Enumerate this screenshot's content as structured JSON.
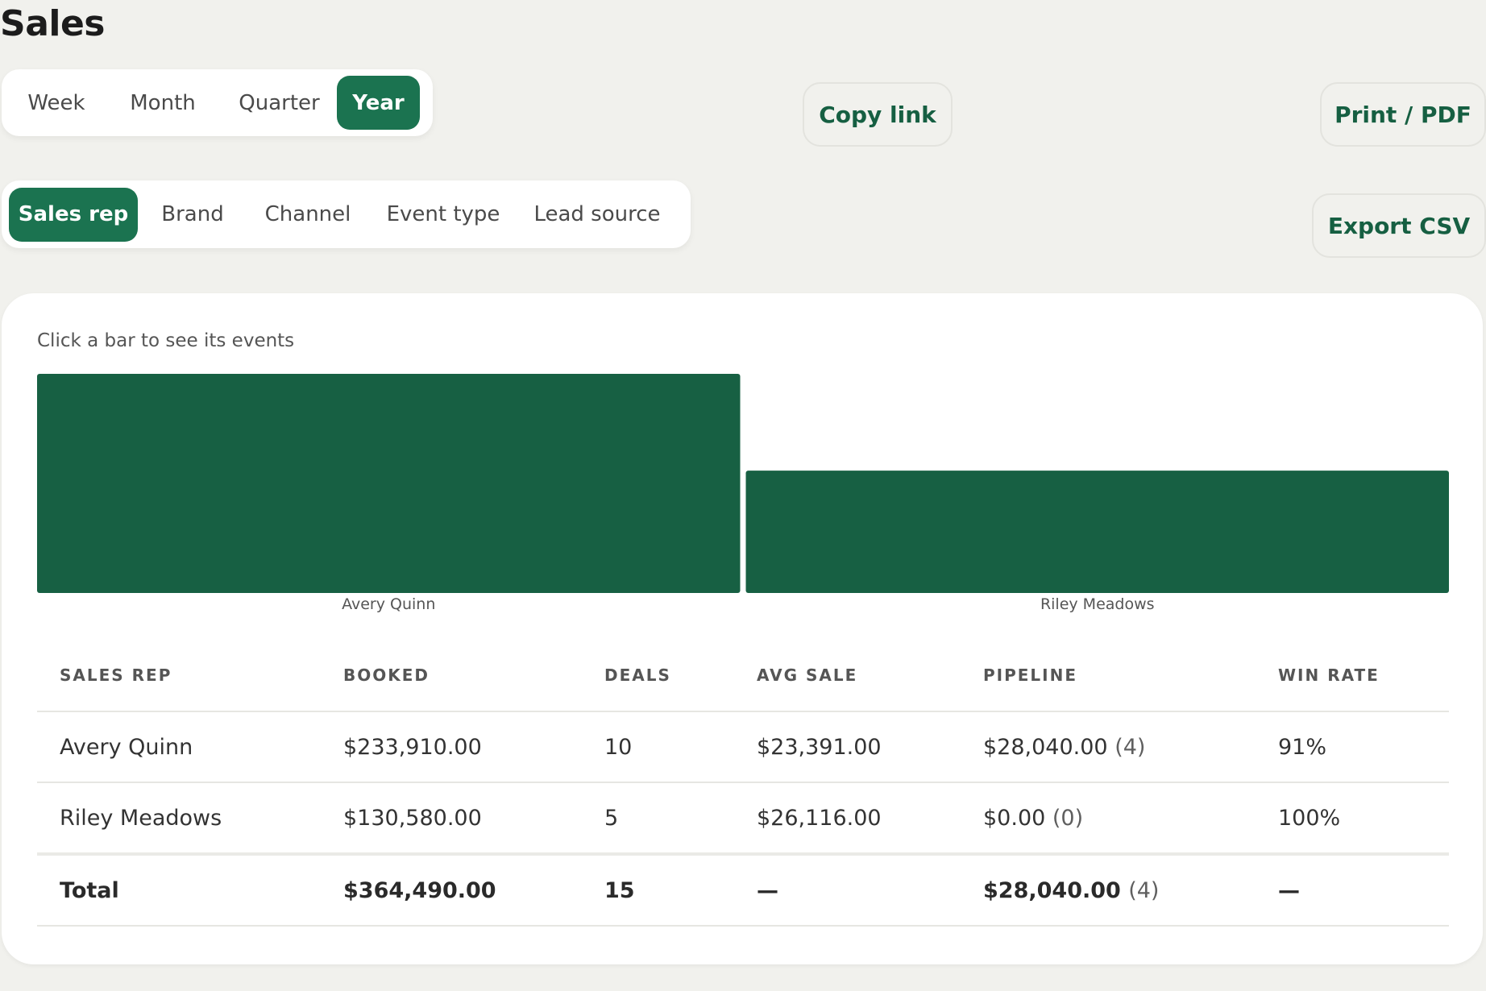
{
  "page": {
    "title": "Sales"
  },
  "period_tabs": {
    "items": [
      {
        "label": "Week"
      },
      {
        "label": "Month"
      },
      {
        "label": "Quarter"
      },
      {
        "label": "Year"
      }
    ],
    "selected": "Year"
  },
  "group_tabs": {
    "items": [
      {
        "label": "Sales rep"
      },
      {
        "label": "Brand"
      },
      {
        "label": "Channel"
      },
      {
        "label": "Event type"
      },
      {
        "label": "Lead source"
      }
    ],
    "selected": "Sales rep"
  },
  "actions": {
    "copy_link": "Copy link",
    "print_pdf": "Print / PDF",
    "export_csv": "Export CSV"
  },
  "chart": {
    "hint": "Click a bar to see its events"
  },
  "colors": {
    "accent": "#1b7350",
    "bar": "#176043",
    "action_text": "#165f42"
  },
  "chart_data": {
    "type": "bar",
    "categories": [
      "Avery Quinn",
      "Riley Meadows"
    ],
    "values": [
      233910,
      130580
    ],
    "title": "",
    "xlabel": "",
    "ylabel": "",
    "ylim": [
      0,
      233910
    ],
    "grid": false
  },
  "table": {
    "headers": [
      "SALES REP",
      "BOOKED",
      "DEALS",
      "AVG SALE",
      "PIPELINE",
      "WIN RATE"
    ],
    "rows": [
      {
        "rep": "Avery Quinn",
        "booked": "$233,910.00",
        "deals": "10",
        "avg_sale": "$23,391.00",
        "pipeline_amount": "$28,040.00",
        "pipeline_count": "(4)",
        "win_rate": "91%"
      },
      {
        "rep": "Riley Meadows",
        "booked": "$130,580.00",
        "deals": "5",
        "avg_sale": "$26,116.00",
        "pipeline_amount": "$0.00",
        "pipeline_count": "(0)",
        "win_rate": "100%"
      }
    ],
    "total": {
      "label": "Total",
      "booked": "$364,490.00",
      "deals": "15",
      "avg_sale": "—",
      "pipeline_amount": "$28,040.00",
      "pipeline_count": "(4)",
      "win_rate": "—"
    }
  }
}
